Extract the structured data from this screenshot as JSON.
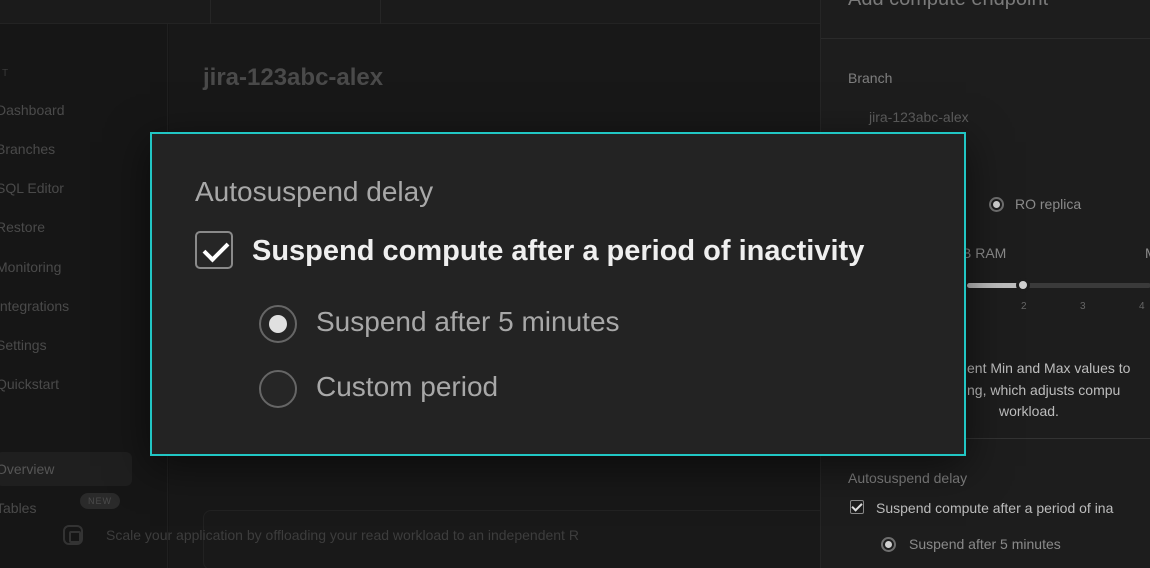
{
  "sidebar": {
    "section_1": "T",
    "items": [
      {
        "label": "Dashboard"
      },
      {
        "label": "Branches"
      },
      {
        "label": "SQL Editor"
      },
      {
        "label": "Restore"
      },
      {
        "label": "Monitoring"
      },
      {
        "label": "Integrations"
      },
      {
        "label": "Settings"
      },
      {
        "label": "Quickstart"
      }
    ],
    "section_2": "",
    "sub_items": [
      {
        "label": "Overview"
      },
      {
        "label": "Tables",
        "badge": "NEW"
      }
    ]
  },
  "main": {
    "title": "jira-123abc-alex",
    "info_text": "Scale your application by offloading your read workload to an independent R"
  },
  "panel": {
    "title": "Add compute endpoint",
    "branch_label": "Branch",
    "branch_value": "jira-123abc-alex",
    "ro_replica_label": "RO replica",
    "ram_label": "B RAM",
    "max_label": "M",
    "ticks": [
      "2",
      "3",
      "4"
    ],
    "slider_value": 2,
    "help_line_1": "ent Min and Max values to",
    "help_line_2": "ng, which adjusts compu",
    "help_line_3": "workload.",
    "autosuspend_label": "Autosuspend delay",
    "suspend_checkbox_label": "Suspend compute after a period of ina",
    "suspend_option_label": "Suspend after 5 minutes"
  },
  "callout": {
    "heading": "Autosuspend delay",
    "checkbox_label": "Suspend compute after a period of inactivity",
    "checkbox_checked": true,
    "options": [
      {
        "label": "Suspend after 5 minutes",
        "selected": true
      },
      {
        "label": "Custom period",
        "selected": false
      }
    ],
    "border_color": "#21c6c4"
  }
}
